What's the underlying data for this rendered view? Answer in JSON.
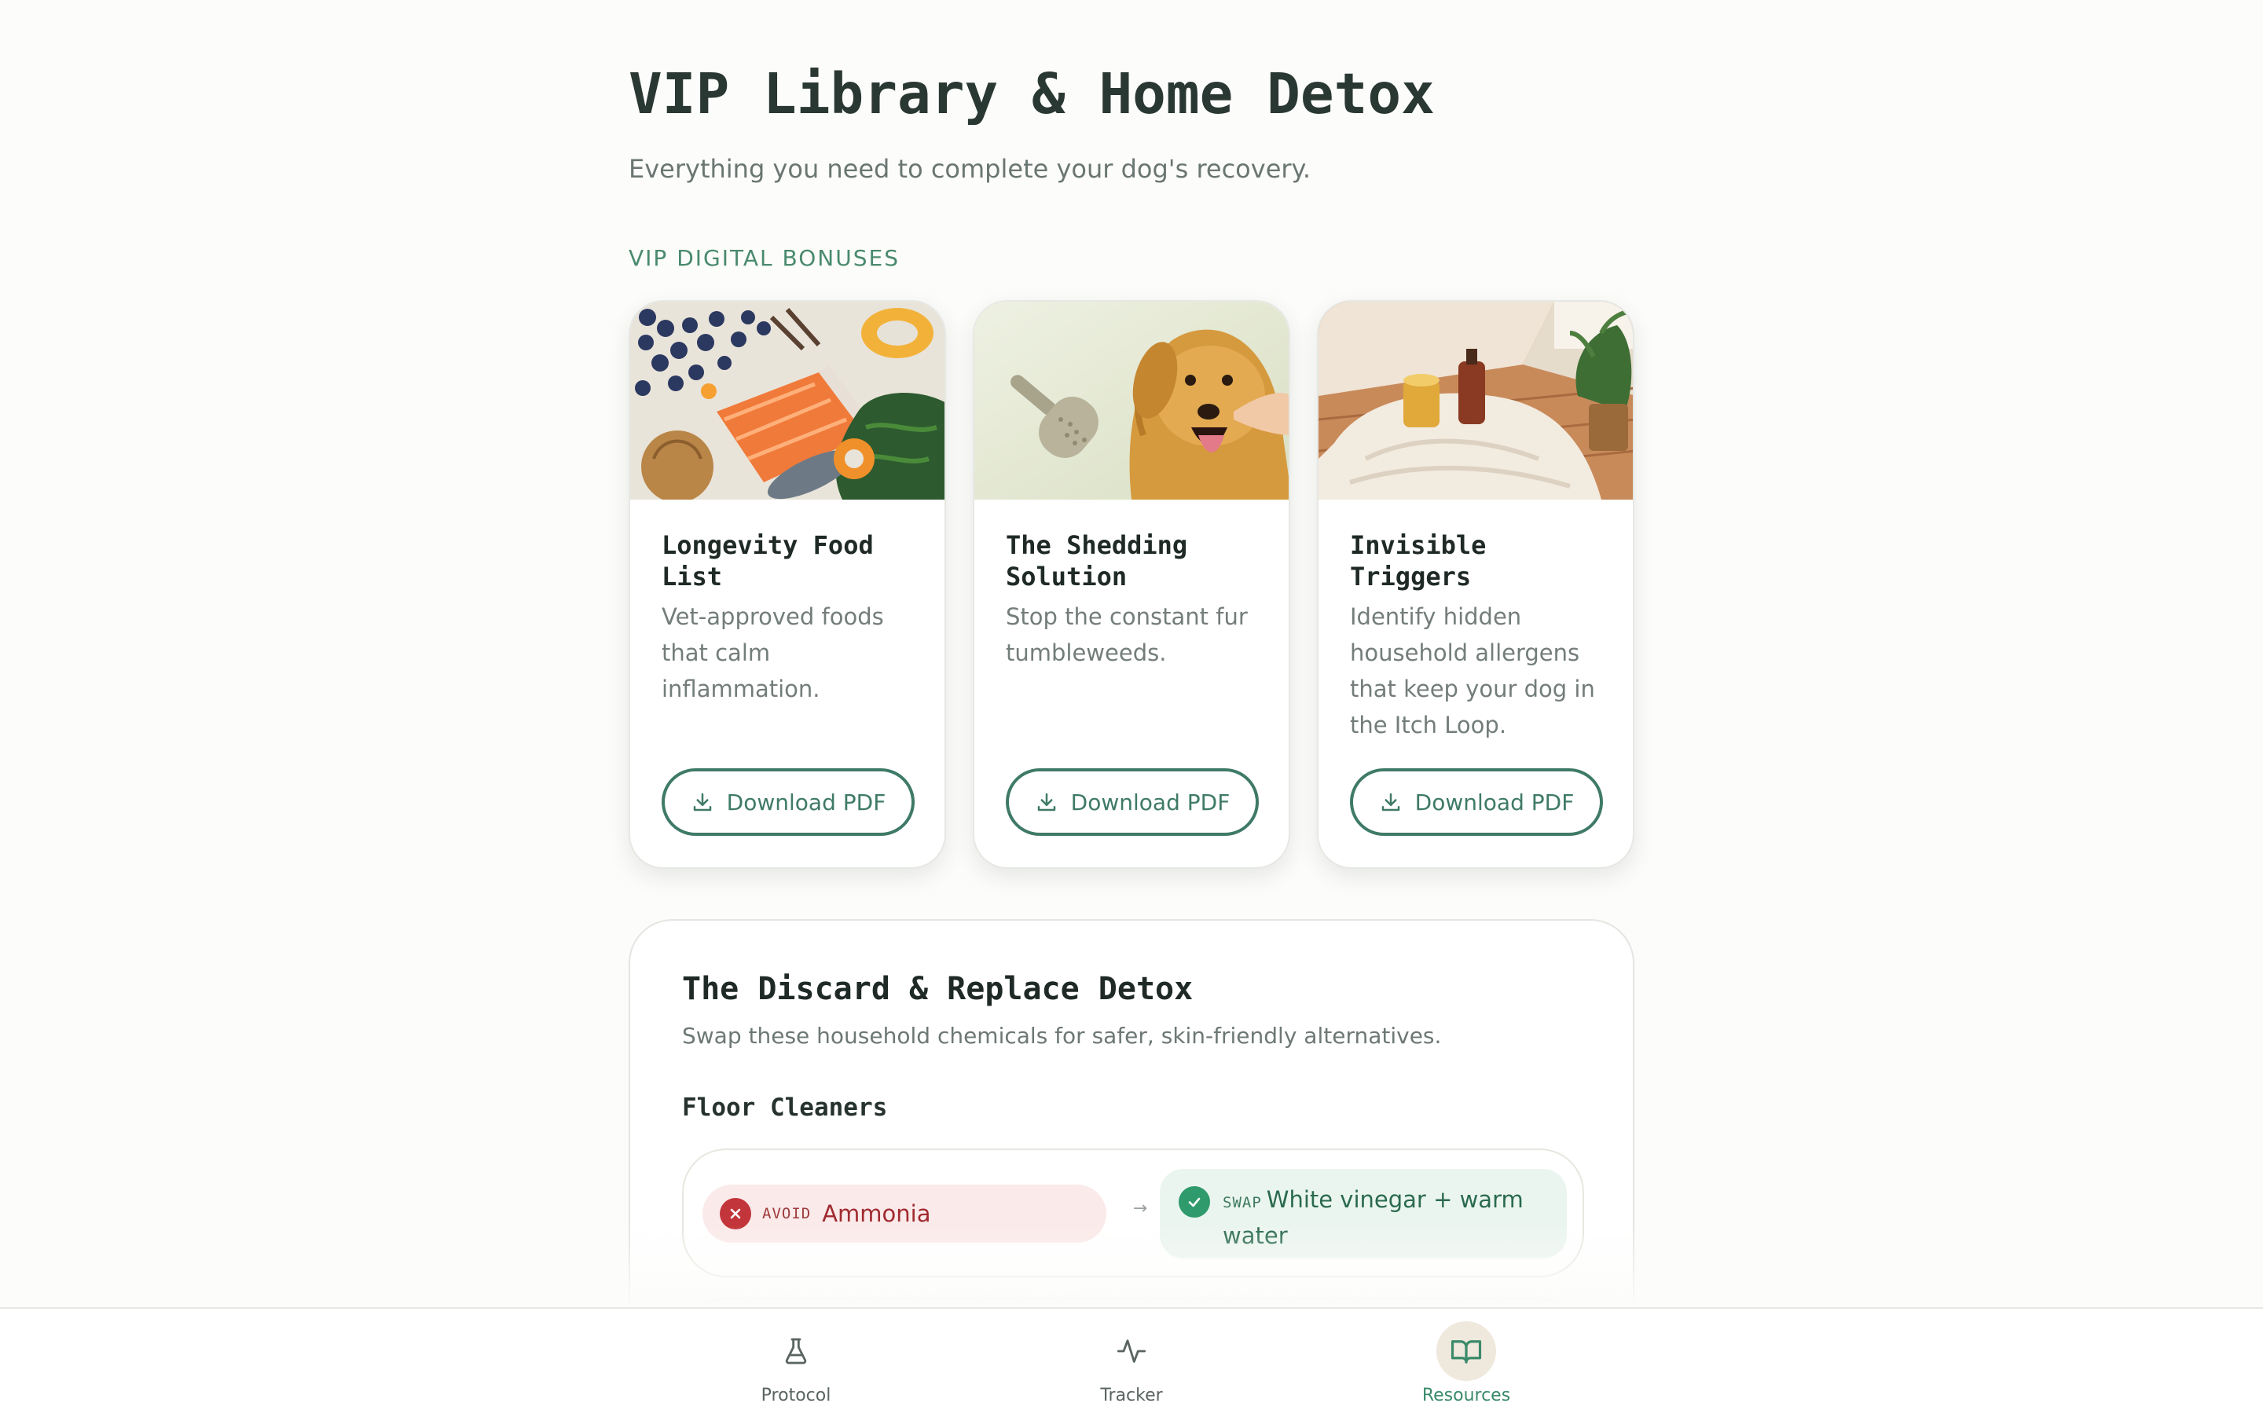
{
  "header": {
    "title": "VIP Library & Home Detox",
    "subtitle": "Everything you need to complete your dog's recovery."
  },
  "bonuses": {
    "section_label": "VIP DIGITAL BONUSES",
    "cards": [
      {
        "title": "Longevity Food List",
        "description": "Vet-approved foods that calm inflammation.",
        "button_label": "Download PDF",
        "image": "food-flatlay-photo"
      },
      {
        "title": "The Shedding Solution",
        "description": "Stop the constant fur tumbleweeds.",
        "button_label": "Download PDF",
        "image": "golden-retriever-brush-photo"
      },
      {
        "title": "Invisible Triggers",
        "description": "Identify hidden household allergens that keep your dog in the Itch Loop.",
        "button_label": "Download PDF",
        "image": "blanket-candle-photo"
      }
    ]
  },
  "detox": {
    "title": "The Discard & Replace Detox",
    "subtitle": "Swap these household chemicals for safer, skin-friendly alternatives.",
    "category": "Floor Cleaners",
    "rows": [
      {
        "avoid_tag": "AVOID",
        "avoid": "Ammonia",
        "arrow": "→",
        "swap_tag": "SWAP",
        "swap": "White vinegar + warm water"
      }
    ]
  },
  "nav": {
    "items": [
      {
        "label": "Protocol",
        "icon": "flask-icon",
        "active": false
      },
      {
        "label": "Tracker",
        "icon": "pulse-icon",
        "active": false
      },
      {
        "label": "Resources",
        "icon": "book-icon",
        "active": true
      }
    ]
  },
  "colors": {
    "accent": "#3f7a68",
    "avoid": "#c2353a",
    "swap": "#2f9a6c",
    "background": "#fcfcfa"
  }
}
